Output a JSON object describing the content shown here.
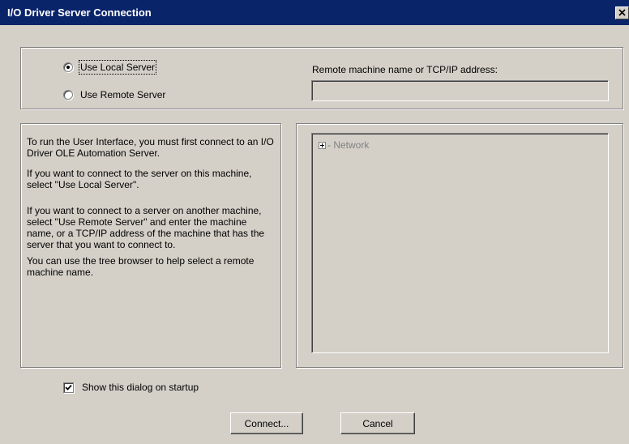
{
  "window": {
    "title": "I/O Driver Server Connection"
  },
  "server_options": {
    "local_label": "Use Local Server",
    "remote_label": "Use Remote Server",
    "selected": "local"
  },
  "remote": {
    "label": "Remote machine name or TCP/IP address:",
    "value": ""
  },
  "help": {
    "paragraphs": [
      "To run the User Interface, you must first connect to an  I/O Driver OLE Automation Server.",
      "If you want to connect to the server on this machine, select \"Use Local Server\".",
      "If you want to connect to a server on another machine, select \"Use Remote Server\" and enter the machine name, or a TCP/IP address of the machine that has the server that you want to connect to.",
      "You can use the tree browser to help select a remote machine name."
    ]
  },
  "tree": {
    "root_label": "Network"
  },
  "startup": {
    "label": "Show this dialog on startup",
    "checked": true
  },
  "buttons": {
    "connect": "Connect...",
    "cancel": "Cancel"
  }
}
